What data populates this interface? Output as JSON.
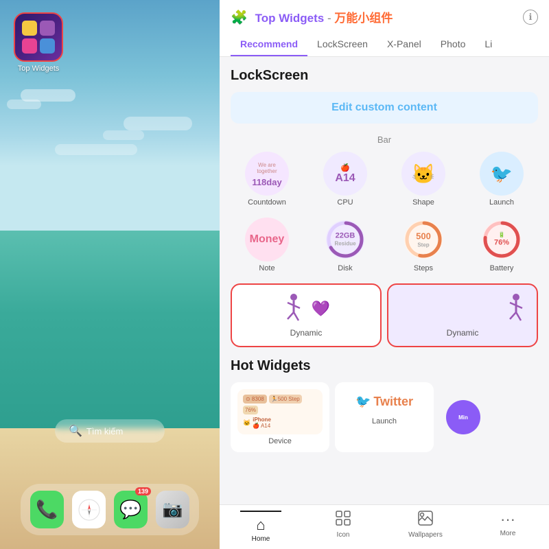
{
  "app": {
    "name": "Top Widgets",
    "subtitle": "万能小组件",
    "info_icon": "ℹ"
  },
  "left_panel": {
    "app_icon_label": "Top Widgets",
    "search_placeholder": "Tìm kiếm",
    "dock_badges": {
      "messages": "139"
    }
  },
  "nav_tabs": [
    {
      "label": "Recommend",
      "active": false
    },
    {
      "label": "LockScreen",
      "active": true
    },
    {
      "label": "X-Panel",
      "active": false
    },
    {
      "label": "Photo",
      "active": false
    },
    {
      "label": "Li",
      "active": false
    }
  ],
  "lockscreen": {
    "title": "LockScreen",
    "edit_button": "Edit custom content",
    "bar_label": "Bar",
    "widgets_row1": [
      {
        "label": "Countdown",
        "top_text": "We are together",
        "main_text": "118day"
      },
      {
        "label": "CPU",
        "main_text": "A14"
      },
      {
        "label": "Shape",
        "emoji": "🐱"
      },
      {
        "label": "Launch",
        "emoji": "🐦"
      }
    ],
    "widgets_row2": [
      {
        "label": "Note",
        "main_text": "Money"
      },
      {
        "label": "Disk",
        "main_text": "22GB",
        "sub_text": "Residue"
      },
      {
        "label": "Steps",
        "main_text": "500",
        "sub_text": "Step"
      },
      {
        "label": "Battery",
        "main_text": "76%"
      }
    ],
    "dynamic_row": [
      {
        "label": "Dynamic"
      },
      {
        "label": "Dynamic"
      }
    ]
  },
  "hot_widgets": {
    "title": "Hot Widgets",
    "items": [
      {
        "label": "Device"
      },
      {
        "label": "Launch"
      },
      {
        "label": "Min"
      }
    ]
  },
  "bottom_nav": [
    {
      "label": "Home",
      "icon": "⌂",
      "active": true
    },
    {
      "label": "Icon",
      "icon": "⊞",
      "active": false
    },
    {
      "label": "Wallpapers",
      "icon": "🖼",
      "active": false
    },
    {
      "label": "More",
      "icon": "···",
      "active": false
    }
  ]
}
